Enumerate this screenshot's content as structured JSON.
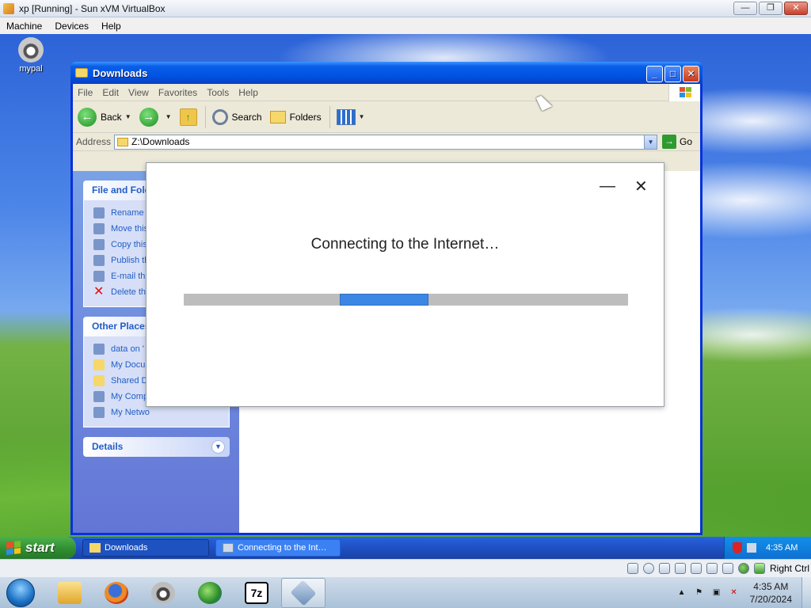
{
  "host_window": {
    "title": "xp [Running] - Sun xVM VirtualBox",
    "menu": [
      "Machine",
      "Devices",
      "Help"
    ],
    "buttons": {
      "minimize": "—",
      "restore": "❐",
      "close": "✕"
    }
  },
  "desktop": {
    "icons": [
      {
        "label": "mypal",
        "icon": "raccoon-icon"
      }
    ]
  },
  "explorer": {
    "title": "Downloads",
    "menu": [
      "File",
      "Edit",
      "View",
      "Favorites",
      "Tools",
      "Help"
    ],
    "toolbar": {
      "back": "Back",
      "search": "Search",
      "folders": "Folders"
    },
    "address_label": "Address",
    "address_value": "Z:\\Downloads",
    "go_label": "Go",
    "panes": {
      "file_tasks": {
        "title": "File and Fold",
        "items": [
          "Rename t",
          "Move this",
          "Copy this",
          "Publish th",
          "E-mail thi",
          "Delete th"
        ]
      },
      "other_places": {
        "title": "Other Places",
        "items": [
          "data on '",
          "My Docu",
          "Shared D",
          "My Comp",
          "My Netwo"
        ]
      },
      "details": {
        "title": "Details"
      }
    }
  },
  "dialog": {
    "message": "Connecting to the Internet…",
    "minimize_glyph": "—",
    "close_glyph": "✕",
    "progress": {
      "start_fraction": 0.352,
      "end_fraction": 0.55,
      "indeterminate": true
    }
  },
  "xp_taskbar": {
    "start_label": "start",
    "buttons": [
      {
        "label": "Downloads",
        "active": true
      },
      {
        "label": "Connecting to the Int…",
        "active": false
      }
    ],
    "clock": "4:35 AM"
  },
  "host_status": {
    "right_ctrl": "Right Ctrl"
  },
  "win7_taskbar": {
    "pinned": [
      "explorer-icon",
      "firefox-icon",
      "mypal-icon",
      "globe-icon",
      "sevenzip-icon",
      "virtualbox-icon"
    ],
    "sevenzip_text": "7z",
    "time": "4:35 AM",
    "date": "7/20/2024"
  },
  "colors": {
    "xp_title_blue": "#0054e3",
    "progress_fill": "#3c87e4",
    "progress_track": "#bdbdbd",
    "start_green": "#2f8b2f"
  }
}
